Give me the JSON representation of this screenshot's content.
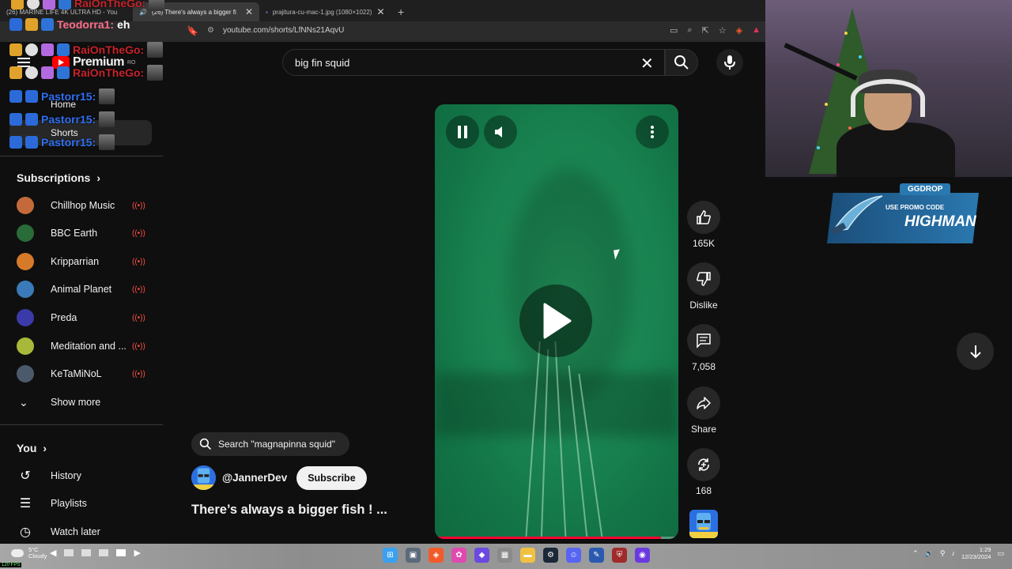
{
  "browser": {
    "tabs": [
      {
        "label": "(26) MARINE LIFE 4K ULTRA HD - You",
        "active": false
      },
      {
        "label": "(26) There's always a bigger fi",
        "active": true
      },
      {
        "label": "prajitura-cu-mac-1.jpg (1080×1022)",
        "active": false
      }
    ],
    "new_tab": "+",
    "close_tab": "✕",
    "url": "youtube.com/shorts/LfNNs21AqvU"
  },
  "chat": [
    {
      "name": "RaiOnTheGo:",
      "message": "",
      "name_color": "#c8232c"
    },
    {
      "name": "Teodorra1:",
      "message": "eh",
      "name_color": "#ff6d8a"
    },
    {
      "name": "RaiOnTheGo:",
      "message": "",
      "name_color": "#c8232c"
    },
    {
      "name": "RaiOnTheGo:",
      "message": "",
      "name_color": "#c8232c"
    },
    {
      "name": "Pastorr15:",
      "message": "",
      "name_color": "#2f6ff0"
    },
    {
      "name": "Pastorr15:",
      "message": "",
      "name_color": "#2f6ff0"
    },
    {
      "name": "Pastorr15:",
      "message": "",
      "name_color": "#2f6ff0"
    }
  ],
  "youtube": {
    "logo": "Premium",
    "logo_region": "RO",
    "nav": {
      "home": "Home",
      "shorts": "Shorts"
    },
    "subscriptions_title": "Subscriptions",
    "subscriptions": [
      {
        "name": "Chillhop Music",
        "color": "#c46a3a"
      },
      {
        "name": "BBC Earth",
        "color": "#2a6b3a"
      },
      {
        "name": "Kripparrian",
        "color": "#d67a2a"
      },
      {
        "name": "Animal Planet",
        "color": "#3a7ab8"
      },
      {
        "name": "Preda",
        "color": "#3a3aa8"
      },
      {
        "name": "Meditation and ...",
        "color": "#a8b83a"
      },
      {
        "name": "KeTaMiNoL",
        "color": "#4a5a6a"
      }
    ],
    "show_more": "Show more",
    "you_title": "You",
    "you_items": [
      {
        "label": "History",
        "icon": "history-icon"
      },
      {
        "label": "Playlists",
        "icon": "playlists-icon"
      },
      {
        "label": "Watch later",
        "icon": "watch-later-icon"
      }
    ],
    "search": {
      "query": "big fin squid"
    },
    "actions": {
      "like": "165K",
      "dislike": "Dislike",
      "comments": "7,058",
      "share": "Share",
      "remix": "168"
    },
    "video_progress": 0.93,
    "search_chip": "Search \"magnapinna squid\"",
    "channel": "@JannerDev",
    "subscribe": "Subscribe",
    "video_title": "There’s always a bigger fish ! ..."
  },
  "promo": {
    "tag": "GGDROP",
    "line1": "USE PROMO CODE",
    "line2": "HIGHMAN"
  },
  "taskbar": {
    "weather_temp": "5°C",
    "weather_desc": "Cloudy",
    "fps": "120 FPS",
    "time": "1:29",
    "date": "12/23/2024"
  }
}
